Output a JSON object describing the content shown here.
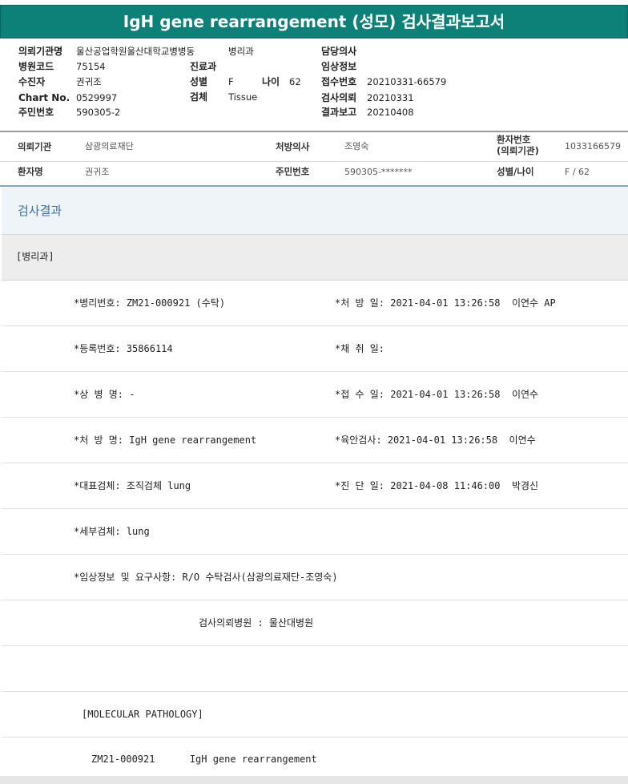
{
  "title": "IgH gene rearrangement (성모) 검사결과보고서",
  "header": {
    "left": [
      {
        "label": "의뢰기관명",
        "value": "울산공업학원울산대학교병병동"
      },
      {
        "label": "병원코드",
        "value": "75154"
      },
      {
        "label": "수진자",
        "value": "권귀조"
      },
      {
        "label": "Chart No.",
        "value": "0529997"
      },
      {
        "label": "주민번호",
        "value": "590305-2"
      }
    ],
    "mid_top_value": "병리과",
    "mid": [
      {
        "label": "진료과",
        "value": ""
      },
      {
        "label": "성별",
        "value": "F"
      },
      {
        "label": "검체",
        "value": "Tissue"
      }
    ],
    "age_label": "나이",
    "age_value": "62",
    "right": [
      {
        "label": "담당의사",
        "value": ""
      },
      {
        "label": "임상정보",
        "value": ""
      },
      {
        "label": "접수번호",
        "value": "20210331-66579"
      },
      {
        "label": "검사의뢰",
        "value": "20210331"
      },
      {
        "label": "결과보고",
        "value": "20210408"
      }
    ]
  },
  "info": {
    "row1": {
      "inst_label": "의뢰기관",
      "inst_value": "삼광의료재단",
      "doctor_label": "처방의사",
      "doctor_value": "조영숙",
      "patient_no_label_1": "환자번호",
      "patient_no_label_2": "(의뢰기관)",
      "patient_no_value": "1033166579"
    },
    "row2": {
      "name_label": "환자명",
      "name_value": "권귀조",
      "rrn_label": "주민번호",
      "rrn_value": "590305-*******",
      "sexage_label": "성별/나이",
      "sexage_value": "F / 62"
    }
  },
  "section_title": "검사결과",
  "dept_label": "[병리과]",
  "rows": [
    {
      "left": "*병리번호: ZM21-000921 (수탁)",
      "right": "*처 방 일: 2021-04-01 13:26:58  이연수 AP"
    },
    {
      "left": "*등록번호: 35866114",
      "right": "*채 취 일:"
    },
    {
      "left": "*상 병 명: -",
      "right": "*접 수 일: 2021-04-01 13:26:58  이연수"
    },
    {
      "left": "*처 방 명: IgH gene rearrangement",
      "right": "*육안검사: 2021-04-01 13:26:58  이연수"
    },
    {
      "left": "*대표검체: 조직검체 lung",
      "right": "*진 단 일: 2021-04-08 11:46:00  박경신"
    },
    {
      "left": "*세부검체: lung",
      "right": ""
    },
    {
      "left": "*임상정보 및 요구사항: R/O 수탁검사(삼광의료재단-조영숙)",
      "right": ""
    }
  ],
  "hospital_line": "검사의뢰병원 : 울산대병원",
  "molecular_label": "[MOLECULAR PATHOLOGY]",
  "molecular_line": "ZM21-000921      IgH gene rearrangement"
}
